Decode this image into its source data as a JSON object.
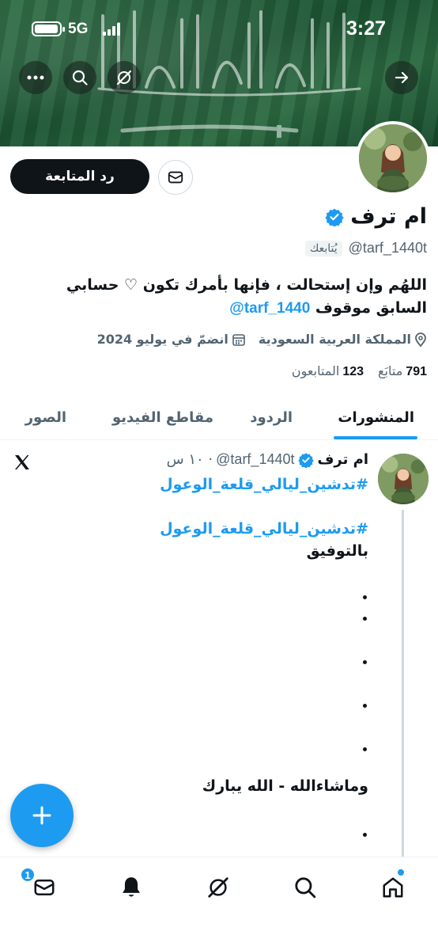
{
  "status_bar": {
    "time": "3:27",
    "network": "5G"
  },
  "profile": {
    "name": "ام ترف",
    "handle": "@tarf_1440t",
    "follows_you": "يُتابعك",
    "follow_back_label": "رد المتابعة",
    "bio_text": "اللهُم وإن إستحالت ، فإنها بأمرك تكون ♡ حسابي السابق موقوف",
    "bio_mention": "@tarf_1440",
    "location": "المملكة العربية السعودية",
    "joined": "انضمّ في يوليو 2024",
    "following_count": "791",
    "following_label": "متابَع",
    "followers_count": "123",
    "followers_label": "المتابعون"
  },
  "tabs": [
    {
      "label": "المنشورات",
      "active": true
    },
    {
      "label": "الردود",
      "active": false
    },
    {
      "label": "مقاطع الفيديو",
      "active": false
    },
    {
      "label": "الصور",
      "active": false
    }
  ],
  "post": {
    "author": "ام ترف",
    "handle": "@tarf_1440t",
    "time": "· ١٠ س",
    "hashtag_1": "#تدشين_ليالي_قلعة_الوعول",
    "hashtag_2": "#تدشين_ليالي_قلعة_الوعول",
    "line_1": "بالتوفيق",
    "blessing": "وماشاءالله - الله يبارك"
  },
  "bottom_nav": {
    "messages_badge": "1"
  },
  "colors": {
    "accent": "#1d9bf0",
    "text": "#0f1419",
    "secondary_text": "#536471",
    "banner_green": "#1c5533"
  }
}
